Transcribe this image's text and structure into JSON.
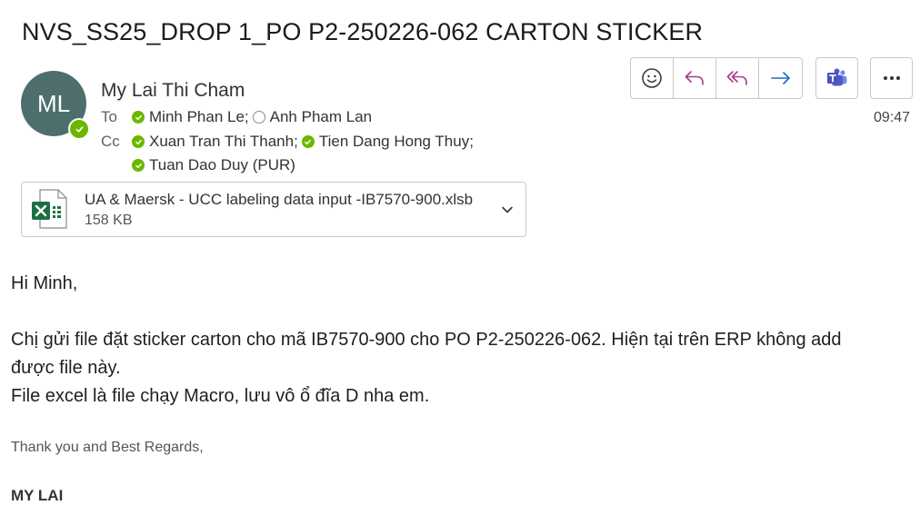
{
  "email": {
    "subject": "NVS_SS25_DROP 1_PO P2-250226-062 CARTON STICKER",
    "time": "09:47"
  },
  "sender": {
    "initials": "ML",
    "name": "My Lai Thi Cham",
    "status": "available",
    "status_color": "#6bb700",
    "avatar_color": "#4d6e6d"
  },
  "to": {
    "label": "To",
    "recipients": [
      {
        "name": "Minh Phan Le;",
        "status": "available"
      },
      {
        "name": "Anh Pham Lan",
        "status": "offline"
      }
    ]
  },
  "cc": {
    "label": "Cc",
    "recipients": [
      {
        "name": "Xuan Tran Thi Thanh;",
        "status": "available"
      },
      {
        "name": "Tien Dang Hong Thuy;",
        "status": "available"
      },
      {
        "name": "Tuan Dao Duy (PUR)",
        "status": "available"
      }
    ]
  },
  "toolbar": {
    "icons": [
      "emoji-icon",
      "reply-icon",
      "reply-all-icon",
      "forward-icon",
      "teams-icon",
      "more-icon"
    ]
  },
  "attachment": {
    "name": "UA & Maersk - UCC labeling data input -IB7570-900.xlsb",
    "size": "158 KB",
    "icon": "excel-file-icon"
  },
  "body": {
    "greeting": "Hi Minh,",
    "line1": "Chị gửi file đặt sticker carton cho mã IB7570-900 cho PO P2-250226-062. Hiện tại trên ERP không add",
    "line2": "được file này.",
    "line3": "File excel là file chạy Macro, lưu vô ổ đĩa D nha em.",
    "signoff": "Thank you and Best Regards,",
    "signature": "MY LAI"
  }
}
